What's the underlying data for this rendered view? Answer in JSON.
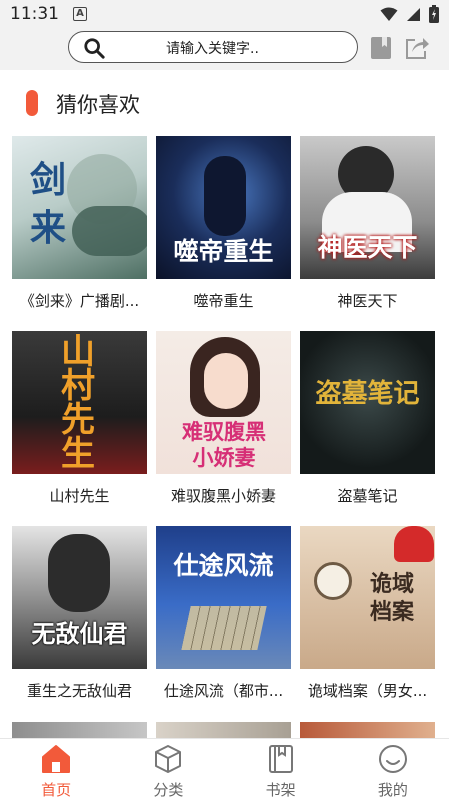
{
  "status_bar": {
    "time": "11:31"
  },
  "search": {
    "placeholder": "请输入关键字.."
  },
  "section": {
    "title": "猜你喜欢"
  },
  "books": [
    {
      "title": "《剑来》广播剧...",
      "cover_text": "剑来"
    },
    {
      "title": "噬帝重生",
      "cover_text": "噬帝重生"
    },
    {
      "title": "神医天下",
      "cover_text": "神医天下"
    },
    {
      "title": "山村先生",
      "cover_text": "山村先生"
    },
    {
      "title": "难驭腹黑小娇妻",
      "cover_text": "难驭腹黑小娇妻"
    },
    {
      "title": "盗墓笔记",
      "cover_text": "盗墓笔记"
    },
    {
      "title": "重生之无敌仙君",
      "cover_text": "无敌仙君"
    },
    {
      "title": "仕途风流（都市...",
      "cover_text": "仕途风流"
    },
    {
      "title": "诡域档案（男女...",
      "cover_text": "诡域档案"
    }
  ],
  "nav": {
    "home": "首页",
    "category": "分类",
    "bookshelf": "书架",
    "mine": "我的"
  },
  "colors": {
    "accent": "#f25a3a",
    "header_bg": "#f2f2f2"
  }
}
